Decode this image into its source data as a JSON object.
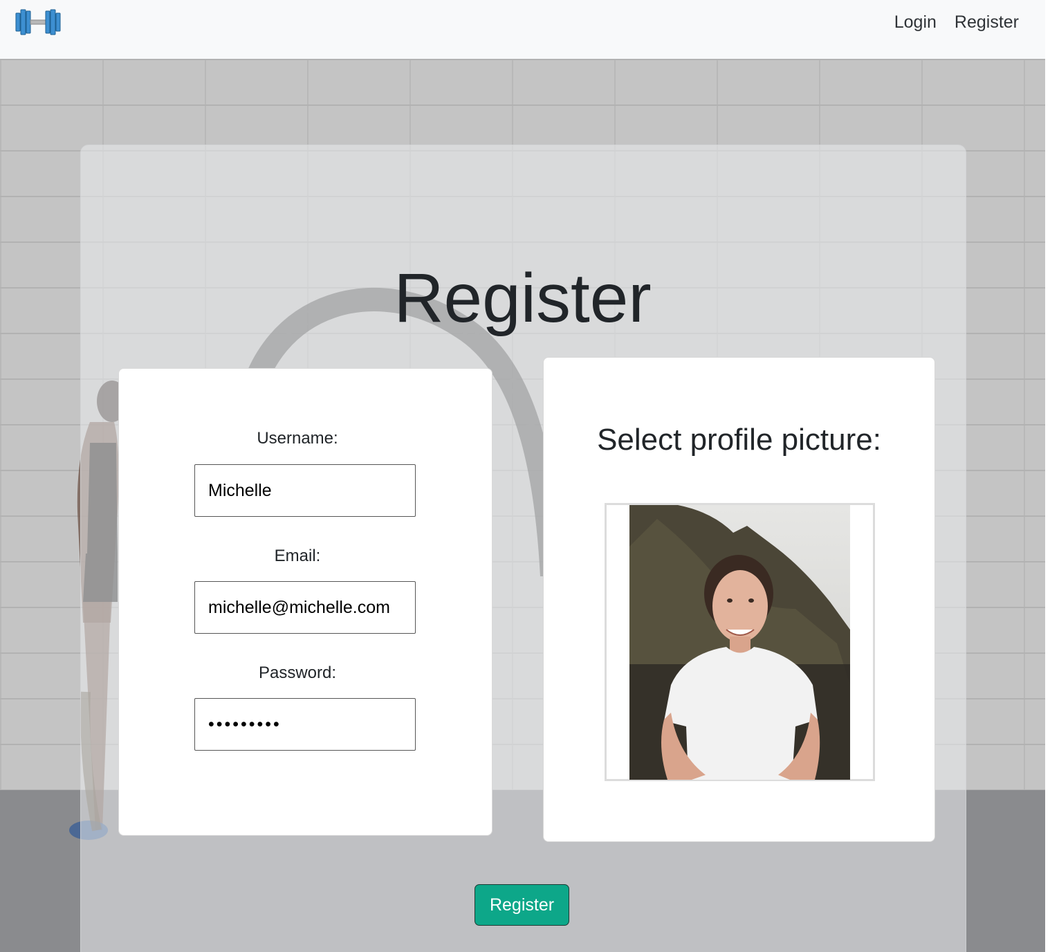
{
  "nav": {
    "logo_icon": "dumbbell-icon",
    "login_label": "Login",
    "register_label": "Register"
  },
  "page": {
    "title": "Register"
  },
  "form": {
    "username_label": "Username:",
    "username_value": "Michelle",
    "email_label": "Email:",
    "email_value": "michelle@michelle.com",
    "password_label": "Password:",
    "password_value": "•••••••••"
  },
  "profile": {
    "title": "Select profile picture:",
    "photo_icon": "profile-photo"
  },
  "actions": {
    "register_button": "Register"
  },
  "colors": {
    "accent": "#0da789",
    "navbar": "#f8f9fa",
    "logo_blue": "#3d8fd1"
  }
}
